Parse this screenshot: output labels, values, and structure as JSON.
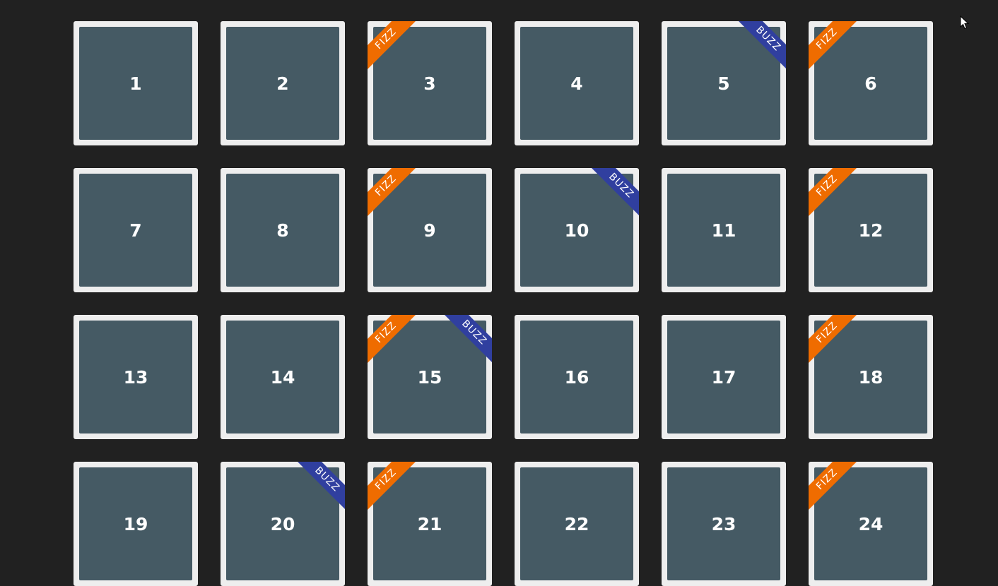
{
  "colors": {
    "background": "#212121",
    "tile_frame": "#eeeeee",
    "tile_fill": "#455a64",
    "fizz": "#ef6c00",
    "buzz": "#303f9f",
    "text": "#ffffff"
  },
  "labels": {
    "fizz": "FIZZ",
    "buzz": "BUZZ"
  },
  "tiles": [
    {
      "number": "1",
      "fizz": false,
      "buzz": false
    },
    {
      "number": "2",
      "fizz": false,
      "buzz": false
    },
    {
      "number": "3",
      "fizz": true,
      "buzz": false
    },
    {
      "number": "4",
      "fizz": false,
      "buzz": false
    },
    {
      "number": "5",
      "fizz": false,
      "buzz": true
    },
    {
      "number": "6",
      "fizz": true,
      "buzz": false
    },
    {
      "number": "7",
      "fizz": false,
      "buzz": false
    },
    {
      "number": "8",
      "fizz": false,
      "buzz": false
    },
    {
      "number": "9",
      "fizz": true,
      "buzz": false
    },
    {
      "number": "10",
      "fizz": false,
      "buzz": true
    },
    {
      "number": "11",
      "fizz": false,
      "buzz": false
    },
    {
      "number": "12",
      "fizz": true,
      "buzz": false
    },
    {
      "number": "13",
      "fizz": false,
      "buzz": false
    },
    {
      "number": "14",
      "fizz": false,
      "buzz": false
    },
    {
      "number": "15",
      "fizz": true,
      "buzz": true
    },
    {
      "number": "16",
      "fizz": false,
      "buzz": false
    },
    {
      "number": "17",
      "fizz": false,
      "buzz": false
    },
    {
      "number": "18",
      "fizz": true,
      "buzz": false
    },
    {
      "number": "19",
      "fizz": false,
      "buzz": false
    },
    {
      "number": "20",
      "fizz": false,
      "buzz": true
    },
    {
      "number": "21",
      "fizz": true,
      "buzz": false
    },
    {
      "number": "22",
      "fizz": false,
      "buzz": false
    },
    {
      "number": "23",
      "fizz": false,
      "buzz": false
    },
    {
      "number": "24",
      "fizz": true,
      "buzz": false
    }
  ],
  "icons": {
    "cursor": "mouse-pointer-icon"
  }
}
